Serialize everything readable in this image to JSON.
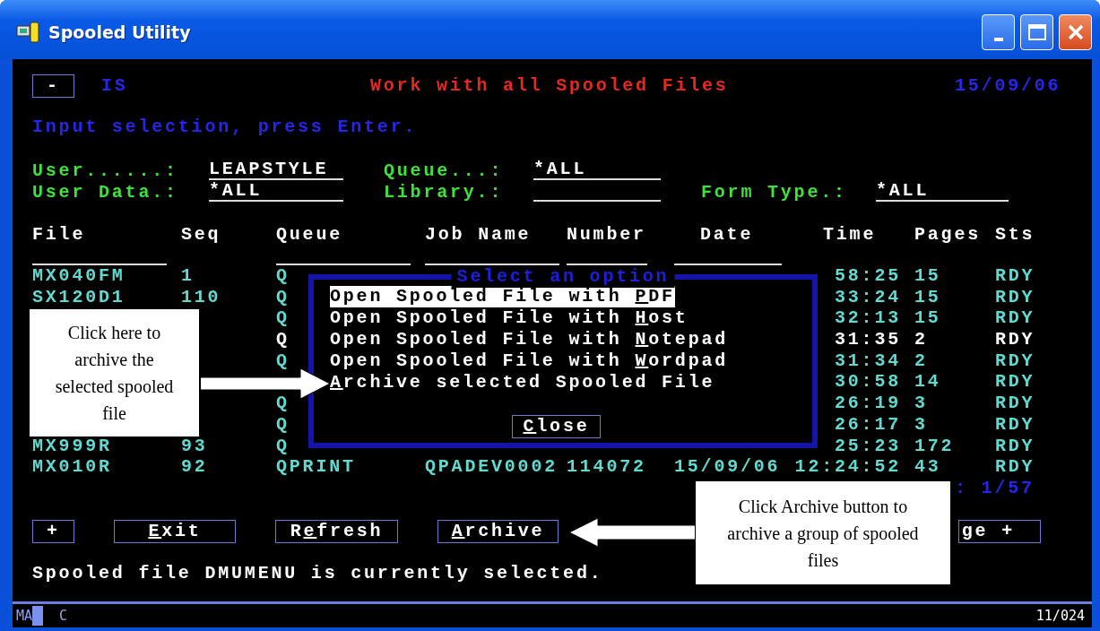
{
  "window": {
    "title": "Spooled Utility"
  },
  "header": {
    "menu_button": "-",
    "system": "IS",
    "title": "Work with all Spooled Files",
    "date": "15/09/06"
  },
  "instruction": "Input selection, press Enter.",
  "filter_rows": [
    [
      {
        "label": "User......:",
        "value": "LEAPSTYLE"
      },
      {
        "label": "Queue...:",
        "value": "*ALL"
      }
    ],
    [
      {
        "label": "User Data.:",
        "value": "*ALL"
      },
      {
        "label": "Library.:"
      },
      {
        "label": "Form Type.:",
        "value": "*ALL"
      }
    ]
  ],
  "table": {
    "columns": [
      "File",
      "Seq",
      "Queue",
      "Job Name",
      "Number",
      "Date",
      "Time",
      "Pages",
      "Sts"
    ],
    "rows": [
      {
        "cells": [
          "MX040FM",
          "1",
          "Q",
          null,
          null,
          null,
          "58:25",
          "15",
          "RDY"
        ],
        "selected": false
      },
      {
        "cells": [
          "SX120D1",
          "110",
          "Q",
          null,
          null,
          null,
          "33:24",
          "15",
          "RDY"
        ],
        "selected": false
      },
      {
        "cells": [
          null,
          null,
          "Q",
          null,
          null,
          null,
          "32:13",
          "15",
          "RDY"
        ],
        "selected": false
      },
      {
        "cells": [
          null,
          null,
          "Q",
          null,
          null,
          null,
          "31:35",
          "2",
          "RDY"
        ],
        "selected": true
      },
      {
        "cells": [
          null,
          null,
          "Q",
          null,
          null,
          null,
          "31:34",
          "2",
          "RDY"
        ],
        "selected": false
      },
      {
        "cells": [
          null,
          null,
          null,
          null,
          null,
          null,
          "30:58",
          "14",
          "RDY"
        ],
        "selected": false
      },
      {
        "cells": [
          null,
          null,
          "Q",
          null,
          null,
          null,
          "26:19",
          "3",
          "RDY"
        ],
        "selected": false
      },
      {
        "cells": [
          null,
          null,
          "Q",
          null,
          null,
          null,
          "26:17",
          "3",
          "RDY"
        ],
        "selected": false
      },
      {
        "cells": [
          "MX999R",
          "93",
          "Q",
          null,
          null,
          null,
          "25:23",
          "172",
          "RDY"
        ],
        "selected": false
      },
      {
        "cells": [
          "MX010R",
          "92",
          "QPRINT",
          "QPADEV0002",
          "114072",
          "15/09/06",
          "12:24:52",
          "43",
          "RDY"
        ],
        "selected": false
      }
    ]
  },
  "position": ": 1/57",
  "buttons": [
    {
      "lead": "+"
    },
    {
      "key": "E",
      "rest": "xit"
    },
    {
      "lead": "R",
      "key": "e",
      "rest": "fresh"
    },
    {
      "key": "A",
      "rest": "rchive"
    },
    {
      "lead": "ge +"
    }
  ],
  "message": "Spooled file DMUMENU is currently selected.",
  "popup": {
    "title": "Select an option",
    "options": [
      {
        "lead": "Open Spooled File with ",
        "key": "P",
        "rest": "DF",
        "selected": true
      },
      {
        "lead": "Open Spooled File with ",
        "key": "H",
        "rest": "ost",
        "selected": false
      },
      {
        "lead": "Open Spooled File with ",
        "key": "N",
        "rest": "otepad",
        "selected": false
      },
      {
        "lead": "Open Spooled File with ",
        "key": "W",
        "rest": "ordpad",
        "selected": false
      },
      {
        "key": "A",
        "rest": "rchive selected Spooled File",
        "selected": false
      }
    ],
    "close": {
      "key": "C",
      "rest": "lose"
    }
  },
  "status_bar": {
    "mode": "MA",
    "indicator": "C",
    "position": "11/024"
  },
  "callouts": [
    {
      "text": "Click here to archive the selected spooled file"
    },
    {
      "text": "Click Archive button to archive a group of spooled files"
    }
  ]
}
